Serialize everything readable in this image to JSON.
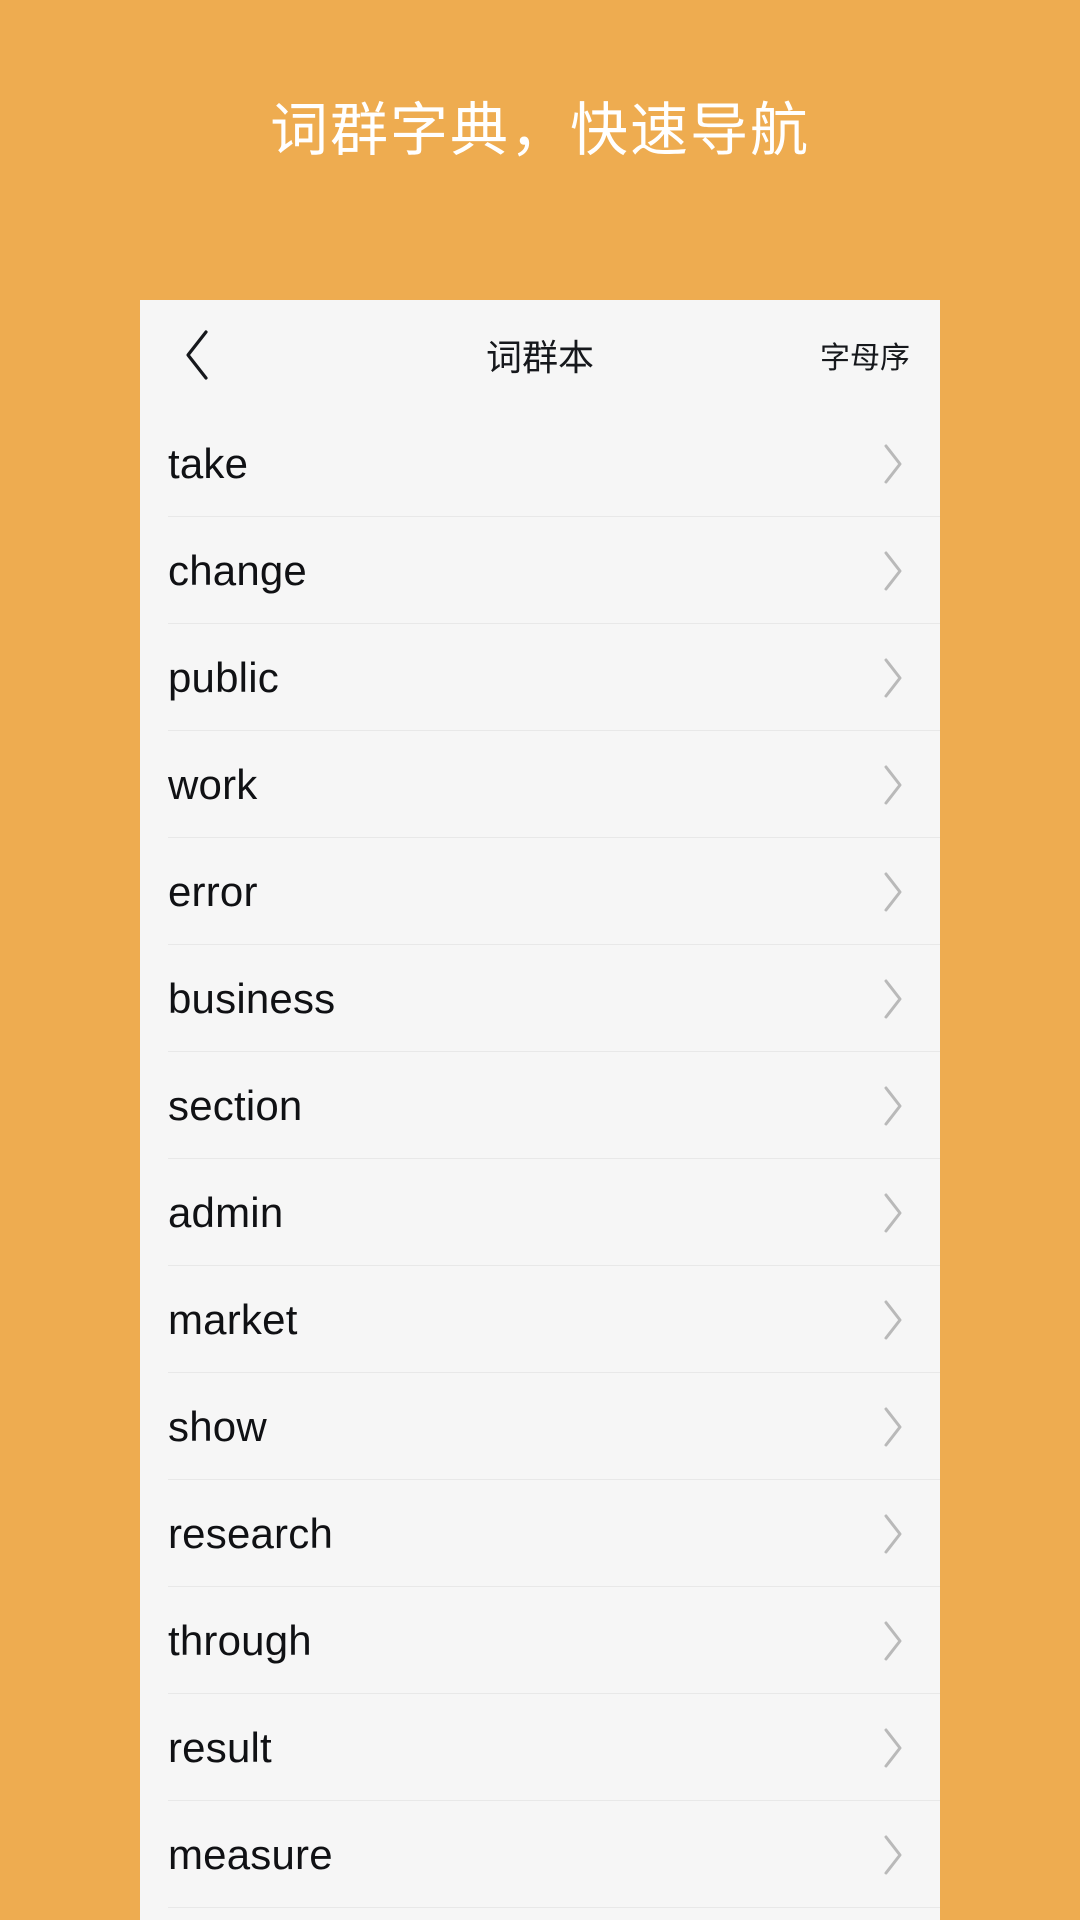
{
  "promo": {
    "headline": "词群字典，快速导航"
  },
  "colors": {
    "background": "#eeac50",
    "card": "#f6f6f6",
    "text": "#101114",
    "divider": "#e8e8e8",
    "chevron": "#b9b9b9",
    "headline_text": "#ffffff"
  },
  "navbar": {
    "back_icon": "chevron-left-icon",
    "title": "词群本",
    "action_label": "字母序"
  },
  "list": {
    "row_chevron_icon": "chevron-right-icon",
    "items": [
      {
        "word": "take"
      },
      {
        "word": "change"
      },
      {
        "word": "public"
      },
      {
        "word": "work"
      },
      {
        "word": "error"
      },
      {
        "word": "business"
      },
      {
        "word": "section"
      },
      {
        "word": "admin"
      },
      {
        "word": "market"
      },
      {
        "word": "show"
      },
      {
        "word": "research"
      },
      {
        "word": "through"
      },
      {
        "word": "result"
      },
      {
        "word": "measure"
      }
    ]
  }
}
